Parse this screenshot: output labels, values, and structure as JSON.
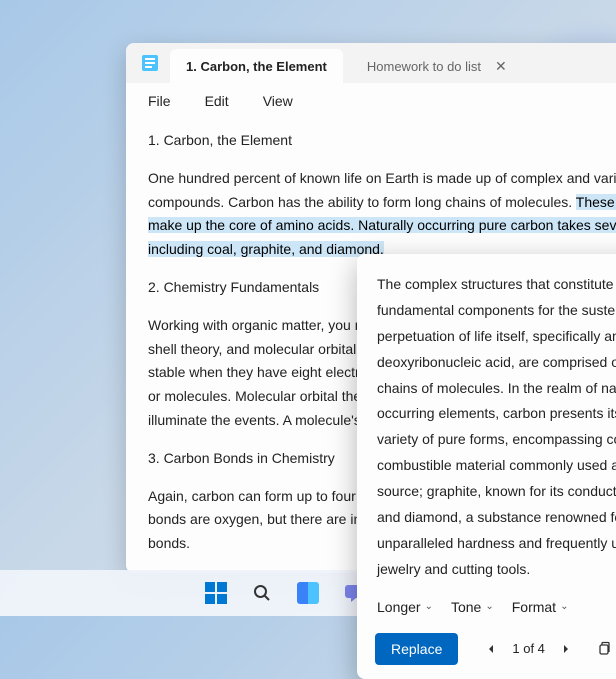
{
  "tabs": {
    "active": "1. Carbon, the Element",
    "inactive": "Homework to do list"
  },
  "menu": {
    "file": "File",
    "edit": "Edit",
    "view": "View"
  },
  "doc": {
    "h1": "1. Carbon, the Element",
    "p1a": "One hundred percent of known life on Earth is made up of complex and varied carbon compounds. Carbon has the ability to form long chains of molecules. ",
    "p1b_hl": "These long chains make up the core of amino acids. Naturally occurring pure carbon takes several forms, including coal, graphite, and diamond.",
    "h2": "2. Chemistry Fundamentals",
    "p2": "Working with organic matter, you need to know about covalent bonds, ionic bonds, valence shell theory, and molecular orbital theory. Valence shell theory—the idea that atoms are most stable when they have eight electrons in its outermost (valence) shell—explains how atoms or molecules. Molecular orbital theory (the physical structures) can help us understand and illuminate the events. A molecule's structure can tell us its basic shape.",
    "h3": "3. Carbon Bonds in Chemistry",
    "p3": "Again, carbon can form up to four bonds with other molecules. In organic chemistry, these bonds are oxygen, but there are infinite possible compounds. In the simplest form, carbon bonds."
  },
  "flyout": {
    "text": "The complex structures that constitute the fundamental components for the sustenance and perpetuation of life itself, specifically amino acids and deoxyribonucleic acid, are comprised of extensive chains of molecules. In the realm of naturally occurring elements, carbon presents itself in a variety of pure forms, encompassing coal, a combustible material commonly used as a fuel source; graphite, known for its conductive properties; and diamond, a substance renowned for its unparalleled hardness and frequently utilized in jewelry and cutting tools.",
    "opt_longer": "Longer",
    "opt_tone": "Tone",
    "opt_format": "Format",
    "replace": "Replace",
    "page": "1 of 4"
  }
}
